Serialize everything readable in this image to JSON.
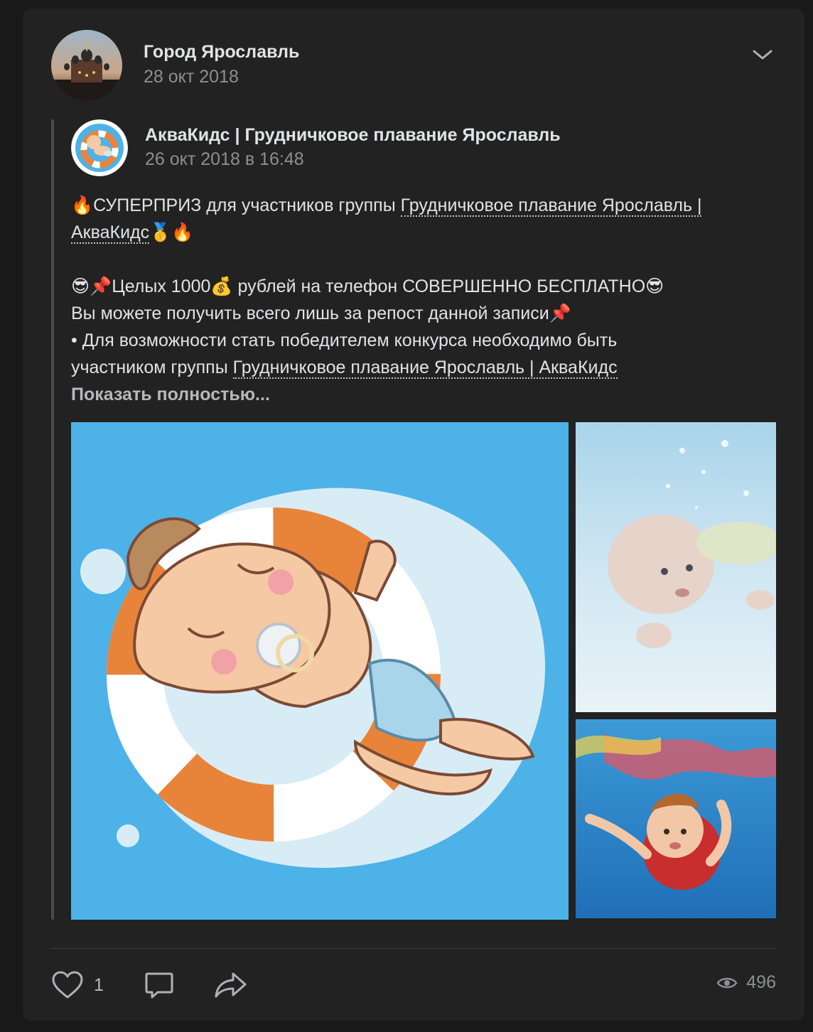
{
  "author": {
    "name": "Город Ярославль",
    "date": "28 окт 2018"
  },
  "repost": {
    "name": "АкваКидс | Грудничковое плавание Ярославль",
    "date": "26 окт 2018 в 16:48"
  },
  "text": {
    "l1_emoji_fire": "🔥",
    "l1_prefix": "СУПЕРПРИЗ для участников группы ",
    "l1_link": "Грудничковое плавание Ярославль |",
    "l2_link": "АкваКидс",
    "l2_emoji_medal": "🥇",
    "l2_emoji_fire": " 🔥",
    "l3_emoji_cool": "😎",
    "l3_emoji_pin": " 📌",
    "l3_text_a": "Целых 1000",
    "l3_emoji_money": "💰",
    "l3_text_b": " рублей на телефон СОВЕРШЕННО БЕСПЛАТНО",
    "l3_emoji_cool_end": "😎",
    "l4_text": "Вы можете получить всего лишь за репост данной записи",
    "l4_emoji_pin": "📌",
    "l5_text": "• Для возможности стать победителем конкурса необходимо быть",
    "l6_prefix": "участником группы ",
    "l6_link": "Грудничковое плавание Ярославль | АкваКидс",
    "show_more": "Показать полностью..."
  },
  "footer": {
    "likes": "1",
    "views": "496"
  },
  "icons": {
    "menu": "chevron-down-icon",
    "like": "heart-icon",
    "comment": "comment-icon",
    "share": "share-icon",
    "views": "eye-icon"
  },
  "colors": {
    "card_bg": "#222222",
    "page_bg": "#19191a",
    "text_primary": "#e1e3e6",
    "text_secondary": "#8b8f95",
    "photo_sky": "#4db2e8",
    "ring_orange": "#e8843a"
  }
}
